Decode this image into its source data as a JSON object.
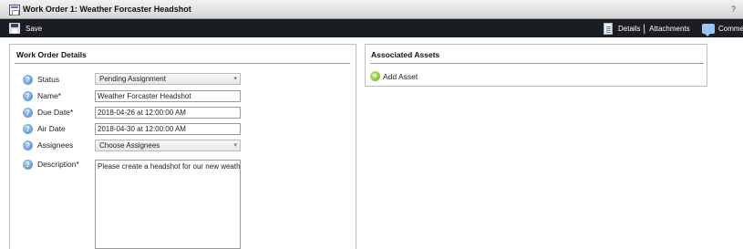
{
  "window": {
    "title": "Work Order 1: Weather Forcaster Headshot",
    "help": "?"
  },
  "toolbar": {
    "save_label": "Save",
    "details_label": "Details",
    "attachments_label": "Attachments",
    "comments_label": "Comme"
  },
  "details": {
    "title": "Work Order Details",
    "status": {
      "label": "Status",
      "value": "Pending Assignment"
    },
    "name": {
      "label": "Name*",
      "value": "Weather Forcaster Headshot"
    },
    "due_date": {
      "label": "Due Date*",
      "value": "2018-04-26 at 12:00:00 AM"
    },
    "air_date": {
      "label": "Air Date",
      "value": "2018-04-30 at 12:00:00 AM"
    },
    "assignees": {
      "label": "Assignees",
      "value": "Choose Assignees"
    },
    "description": {
      "label": "Description*",
      "value": "Please create a headshot for our new weather"
    }
  },
  "assets": {
    "title": "Associated Assets",
    "add_label": "Add Asset"
  },
  "icons": {
    "window": "window-icon",
    "save": "floppy-disk-icon",
    "details": "document-icon",
    "attachments": "paperclip-icon",
    "comments": "speech-bubble-icon",
    "help": "help-circle-icon",
    "add": "plus-circle-icon",
    "dropdown": "chevron-down-icon"
  }
}
